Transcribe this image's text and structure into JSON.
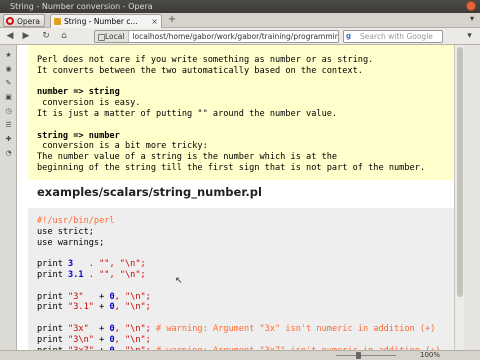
{
  "window": {
    "title": "String - Number conversion - Opera"
  },
  "tabs": {
    "opera_label": "Opera",
    "active_tab_label": "String - Number c...",
    "close": "×",
    "new_tab": "+"
  },
  "address": {
    "location_label": "Local",
    "url": "localhost/home/gabor/work/gabor/training/programming_pe",
    "search_placeholder": "Search with Google",
    "search_engine_glyph": "g"
  },
  "icons": {
    "back": "◀",
    "forward": "▶",
    "reload": "↻",
    "home": "⌂",
    "menu": "▾"
  },
  "notes": {
    "line1": "Perl does not care if you write something as number or as string.",
    "line2": "It converts between the two automatically based on the context.",
    "h1": "number => string",
    "h1_line1": " conversion is easy.",
    "h1_line2": "It is just a matter of putting \"\" around the number value.",
    "h2": "string => number",
    "h2_line1": " conversion is a bit more tricky:",
    "h2_line2": "The number value of a string is the number which is at the",
    "h2_line3": "beginning of the string till the first sign that is not part of the number."
  },
  "example": {
    "filename": "examples/scalars/string_number.pl",
    "lines": [
      {
        "c": "#!/usr/bin/perl"
      },
      {
        "k": "use strict;"
      },
      {
        "k": "use warnings;"
      },
      {
        "blank": true
      },
      {
        "k": "print ",
        "n": "3",
        "s": "   . \"\", \"\\n\";"
      },
      {
        "k": "print ",
        "n": "3.1",
        "s": " . \"\", \"\\n\";"
      },
      {
        "blank": true
      },
      {
        "k": "print ",
        "q": "\"3\"",
        "p": "   + ",
        "n": "0",
        "s": ", \"\\n\";"
      },
      {
        "k": "print ",
        "q": "\"3.1\"",
        "p": " + ",
        "n": "0",
        "s": ", \"\\n\";"
      },
      {
        "blank": true
      },
      {
        "k": "print ",
        "q": "\"3x\"",
        "p": "  + ",
        "n": "0",
        "s": ", \"\\n\";",
        "c": " # warning: Argument \"3x\" isn't numeric in addition (+)"
      },
      {
        "k": "print ",
        "q": "\"3\\n\"",
        "p": " + ",
        "n": "0",
        "s": ", \"\\n\";"
      },
      {
        "k": "print ",
        "q": "\"3x7\"",
        "p": " + ",
        "n": "0",
        "s": ", \"\\n\";",
        "c": " # warning: Argument \"3x7\" isn't numeric in addition (+)"
      }
    ]
  },
  "status": {
    "zoom": "100%"
  }
}
